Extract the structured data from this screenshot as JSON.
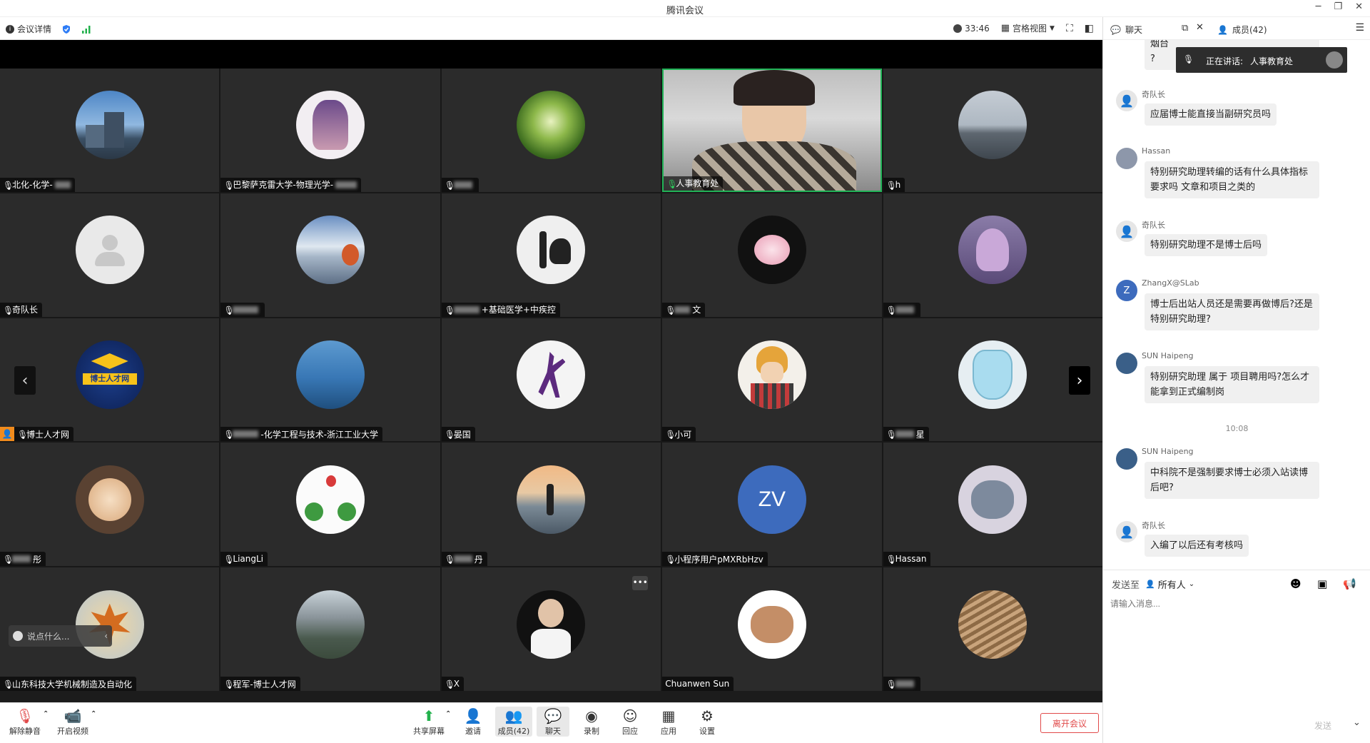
{
  "window": {
    "title": "腾讯会议"
  },
  "toolbar": {
    "meeting_details": "会议详情",
    "timer": "33:46",
    "view_mode": "宫格视图"
  },
  "panel": {
    "chat_tab": "聊天",
    "members_tab": "成员(42)"
  },
  "speaking": {
    "label": "正在讲话:",
    "name": "人事教育处"
  },
  "participants": [
    "北化-化学-",
    "巴黎萨克雷大学-物理光学-",
    "",
    "人事教育处",
    "h",
    "奇队长",
    "",
    "+基础医学+中疾控",
    "文",
    "",
    "博士人才网",
    "-化学工程与技术-浙江工业大学",
    "晏国",
    "小可",
    "星",
    "彤",
    "LiangLi",
    "丹",
    "小程序用户pMXRbHzv",
    "Hassan",
    "山东科技大学机械制造及自动化",
    "程军-博士人才网",
    "X",
    "Chuanwen Sun",
    ""
  ],
  "zv_initials": "ZV",
  "bottom": {
    "unmute": "解除静音",
    "video": "开启视频",
    "share": "共享屏幕",
    "invite": "邀请",
    "members": "成员(42)",
    "chat": "聊天",
    "record": "录制",
    "react": "回应",
    "apps": "应用",
    "settings": "设置",
    "leave": "离开会议"
  },
  "say_something": "说点什么...",
  "chat": {
    "top_partial": "烟台",
    "top_partial2": "?",
    "messages": [
      {
        "name": "奇队长",
        "text": "应届博士能直接当副研究员吗"
      },
      {
        "name": "Hassan",
        "text": "特别研究助理转编的话有什么具体指标要求吗 文章和项目之类的"
      },
      {
        "name": "奇队长",
        "text": "特别研究助理不是博士后吗"
      },
      {
        "name": "ZhangX@SLab",
        "text": "博士后出站人员还是需要再做博后?还是特别研究助理?"
      },
      {
        "name": "SUN Haipeng",
        "text": "特别研究助理 属于 项目聘用吗?怎么才能拿到正式编制岗"
      },
      {
        "name": "SUN Haipeng",
        "text": "中科院不是强制要求博士必须入站读博后吧?"
      },
      {
        "name": "奇队长",
        "text": "入编了以后还有考核吗"
      }
    ],
    "time_divider": "10:08",
    "zhangx_initial": "Z"
  },
  "compose": {
    "send_to": "发送至",
    "audience": "所有人",
    "placeholder": "请输入消息...",
    "send": "发送"
  }
}
